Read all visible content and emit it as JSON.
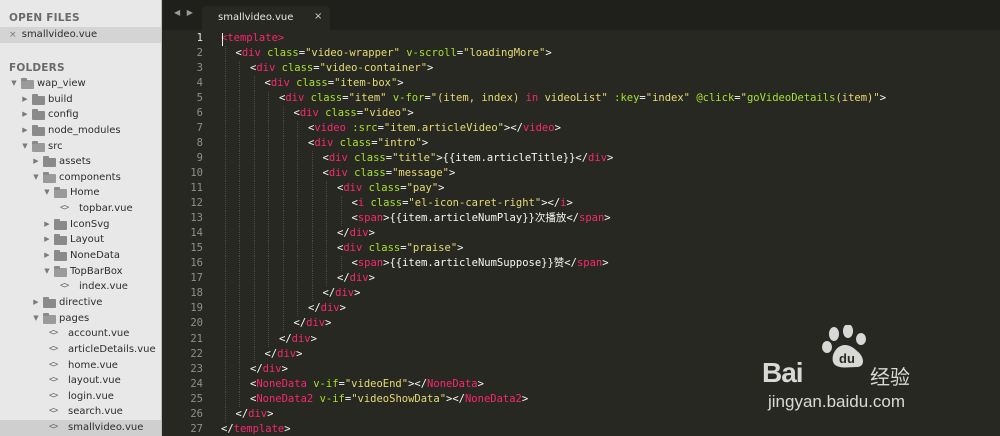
{
  "sidebar": {
    "open_files_title": "OPEN FILES",
    "open_files": [
      {
        "name": "smallvideo.vue",
        "close_glyph": "×"
      }
    ],
    "folders_title": "FOLDERS",
    "tree": [
      {
        "name": "wap_view",
        "type": "folder",
        "level": 0,
        "expanded": true
      },
      {
        "name": "build",
        "type": "folder",
        "level": 1,
        "expanded": false
      },
      {
        "name": "config",
        "type": "folder",
        "level": 1,
        "expanded": false
      },
      {
        "name": "node_modules",
        "type": "folder",
        "level": 1,
        "expanded": false
      },
      {
        "name": "src",
        "type": "folder",
        "level": 1,
        "expanded": true
      },
      {
        "name": "assets",
        "type": "folder",
        "level": 2,
        "expanded": false
      },
      {
        "name": "components",
        "type": "folder",
        "level": 2,
        "expanded": true
      },
      {
        "name": "Home",
        "type": "folder",
        "level": 3,
        "expanded": true
      },
      {
        "name": "topbar.vue",
        "type": "file",
        "level": 4
      },
      {
        "name": "IconSvg",
        "type": "folder",
        "level": 3,
        "expanded": false
      },
      {
        "name": "Layout",
        "type": "folder",
        "level": 3,
        "expanded": false
      },
      {
        "name": "NoneData",
        "type": "folder",
        "level": 3,
        "expanded": false
      },
      {
        "name": "TopBarBox",
        "type": "folder",
        "level": 3,
        "expanded": true
      },
      {
        "name": "index.vue",
        "type": "file",
        "level": 4
      },
      {
        "name": "directive",
        "type": "folder",
        "level": 2,
        "expanded": false
      },
      {
        "name": "pages",
        "type": "folder",
        "level": 2,
        "expanded": true
      },
      {
        "name": "account.vue",
        "type": "file",
        "level": 3
      },
      {
        "name": "articleDetails.vue",
        "type": "file",
        "level": 3
      },
      {
        "name": "home.vue",
        "type": "file",
        "level": 3
      },
      {
        "name": "layout.vue",
        "type": "file",
        "level": 3
      },
      {
        "name": "login.vue",
        "type": "file",
        "level": 3
      },
      {
        "name": "search.vue",
        "type": "file",
        "level": 3
      },
      {
        "name": "smallvideo.vue",
        "type": "file",
        "level": 3,
        "selected": true
      }
    ]
  },
  "tabbar": {
    "nav_arrows": "◀ ▶",
    "active_tab": {
      "label": "smallvideo.vue",
      "close_glyph": "×"
    }
  },
  "editor": {
    "current_line": 1,
    "lines": [
      {
        "n": "1",
        "indent": 0,
        "tokens": [
          [
            "t",
            "<template>"
          ]
        ]
      },
      {
        "n": "2",
        "indent": 1,
        "tokens": [
          [
            "p",
            "<"
          ],
          [
            "t",
            "div"
          ],
          [
            "p",
            " "
          ],
          [
            "a",
            "class"
          ],
          [
            "p",
            "="
          ],
          [
            "s",
            "\"video-wrapper\""
          ],
          [
            "p",
            " "
          ],
          [
            "a",
            "v-scroll"
          ],
          [
            "p",
            "="
          ],
          [
            "s",
            "\"loadingMore\""
          ],
          [
            "p",
            ">"
          ]
        ]
      },
      {
        "n": "3",
        "indent": 2,
        "tokens": [
          [
            "p",
            "<"
          ],
          [
            "t",
            "div"
          ],
          [
            "p",
            " "
          ],
          [
            "a",
            "class"
          ],
          [
            "p",
            "="
          ],
          [
            "s",
            "\"video-container\""
          ],
          [
            "p",
            ">"
          ]
        ]
      },
      {
        "n": "4",
        "indent": 3,
        "tokens": [
          [
            "p",
            "<"
          ],
          [
            "t",
            "div"
          ],
          [
            "p",
            " "
          ],
          [
            "a",
            "class"
          ],
          [
            "p",
            "="
          ],
          [
            "s",
            "\"item-box\""
          ],
          [
            "p",
            ">"
          ]
        ]
      },
      {
        "n": "5",
        "indent": 4,
        "tokens": [
          [
            "p",
            "<"
          ],
          [
            "t",
            "div"
          ],
          [
            "p",
            " "
          ],
          [
            "a",
            "class"
          ],
          [
            "p",
            "="
          ],
          [
            "s",
            "\"item\""
          ],
          [
            "p",
            " "
          ],
          [
            "a",
            "v-for"
          ],
          [
            "p",
            "="
          ],
          [
            "s",
            "\"(item, index) "
          ],
          [
            "k",
            "in"
          ],
          [
            "s",
            " videoList\""
          ],
          [
            "p",
            " "
          ],
          [
            "a",
            ":key"
          ],
          [
            "p",
            "="
          ],
          [
            "s",
            "\"index\""
          ],
          [
            "p",
            " "
          ],
          [
            "a",
            "@click"
          ],
          [
            "p",
            "="
          ],
          [
            "s",
            "\""
          ],
          [
            "a",
            "goVideoDetails"
          ],
          [
            "s",
            "(item)\""
          ],
          [
            "p",
            ">"
          ]
        ]
      },
      {
        "n": "6",
        "indent": 5,
        "tokens": [
          [
            "p",
            "<"
          ],
          [
            "t",
            "div"
          ],
          [
            "p",
            " "
          ],
          [
            "a",
            "class"
          ],
          [
            "p",
            "="
          ],
          [
            "s",
            "\"video\""
          ],
          [
            "p",
            ">"
          ]
        ]
      },
      {
        "n": "7",
        "indent": 6,
        "tokens": [
          [
            "p",
            "<"
          ],
          [
            "t",
            "video"
          ],
          [
            "p",
            " "
          ],
          [
            "a",
            ":src"
          ],
          [
            "p",
            "="
          ],
          [
            "s",
            "\"item.articleVideo\""
          ],
          [
            "p",
            "></"
          ],
          [
            "t",
            "video"
          ],
          [
            "p",
            ">"
          ]
        ]
      },
      {
        "n": "8",
        "indent": 6,
        "tokens": [
          [
            "p",
            "<"
          ],
          [
            "t",
            "div"
          ],
          [
            "p",
            " "
          ],
          [
            "a",
            "class"
          ],
          [
            "p",
            "="
          ],
          [
            "s",
            "\"intro\""
          ],
          [
            "p",
            ">"
          ]
        ]
      },
      {
        "n": "9",
        "indent": 7,
        "tokens": [
          [
            "p",
            "<"
          ],
          [
            "t",
            "div"
          ],
          [
            "p",
            " "
          ],
          [
            "a",
            "class"
          ],
          [
            "p",
            "="
          ],
          [
            "s",
            "\"title\""
          ],
          [
            "p",
            ">{{item.articleTitle}}</"
          ],
          [
            "t",
            "div"
          ],
          [
            "p",
            ">"
          ]
        ]
      },
      {
        "n": "10",
        "indent": 7,
        "tokens": [
          [
            "p",
            "<"
          ],
          [
            "t",
            "div"
          ],
          [
            "p",
            " "
          ],
          [
            "a",
            "class"
          ],
          [
            "p",
            "="
          ],
          [
            "s",
            "\"message\""
          ],
          [
            "p",
            ">"
          ]
        ]
      },
      {
        "n": "11",
        "indent": 8,
        "tokens": [
          [
            "p",
            "<"
          ],
          [
            "t",
            "div"
          ],
          [
            "p",
            " "
          ],
          [
            "a",
            "class"
          ],
          [
            "p",
            "="
          ],
          [
            "s",
            "\"pay\""
          ],
          [
            "p",
            ">"
          ]
        ]
      },
      {
        "n": "12",
        "indent": 9,
        "tokens": [
          [
            "p",
            "<"
          ],
          [
            "t",
            "i"
          ],
          [
            "p",
            " "
          ],
          [
            "a",
            "class"
          ],
          [
            "p",
            "="
          ],
          [
            "s",
            "\"el-icon-caret-right\""
          ],
          [
            "p",
            "></"
          ],
          [
            "t",
            "i"
          ],
          [
            "p",
            ">"
          ]
        ]
      },
      {
        "n": "13",
        "indent": 9,
        "tokens": [
          [
            "p",
            "<"
          ],
          [
            "t",
            "span"
          ],
          [
            "p",
            ">{{item.articleNumPlay}}次播放</"
          ],
          [
            "t",
            "span"
          ],
          [
            "p",
            ">"
          ]
        ]
      },
      {
        "n": "14",
        "indent": 8,
        "tokens": [
          [
            "p",
            "</"
          ],
          [
            "t",
            "div"
          ],
          [
            "p",
            ">"
          ]
        ]
      },
      {
        "n": "15",
        "indent": 8,
        "tokens": [
          [
            "p",
            "<"
          ],
          [
            "t",
            "div"
          ],
          [
            "p",
            " "
          ],
          [
            "a",
            "class"
          ],
          [
            "p",
            "="
          ],
          [
            "s",
            "\"praise\""
          ],
          [
            "p",
            ">"
          ]
        ]
      },
      {
        "n": "16",
        "indent": 9,
        "tokens": [
          [
            "p",
            "<"
          ],
          [
            "t",
            "span"
          ],
          [
            "p",
            ">{{item.articleNumSuppose}}赞</"
          ],
          [
            "t",
            "span"
          ],
          [
            "p",
            ">"
          ]
        ]
      },
      {
        "n": "17",
        "indent": 8,
        "tokens": [
          [
            "p",
            "</"
          ],
          [
            "t",
            "div"
          ],
          [
            "p",
            ">"
          ]
        ]
      },
      {
        "n": "18",
        "indent": 7,
        "tokens": [
          [
            "p",
            "</"
          ],
          [
            "t",
            "div"
          ],
          [
            "p",
            ">"
          ]
        ]
      },
      {
        "n": "19",
        "indent": 6,
        "tokens": [
          [
            "p",
            "</"
          ],
          [
            "t",
            "div"
          ],
          [
            "p",
            ">"
          ]
        ]
      },
      {
        "n": "20",
        "indent": 5,
        "tokens": [
          [
            "p",
            "</"
          ],
          [
            "t",
            "div"
          ],
          [
            "p",
            ">"
          ]
        ]
      },
      {
        "n": "21",
        "indent": 4,
        "tokens": [
          [
            "p",
            "</"
          ],
          [
            "t",
            "div"
          ],
          [
            "p",
            ">"
          ]
        ]
      },
      {
        "n": "22",
        "indent": 3,
        "tokens": [
          [
            "p",
            "</"
          ],
          [
            "t",
            "div"
          ],
          [
            "p",
            ">"
          ]
        ]
      },
      {
        "n": "23",
        "indent": 2,
        "tokens": [
          [
            "p",
            "</"
          ],
          [
            "t",
            "div"
          ],
          [
            "p",
            ">"
          ]
        ]
      },
      {
        "n": "24",
        "indent": 2,
        "tokens": [
          [
            "p",
            "<"
          ],
          [
            "t",
            "NoneData"
          ],
          [
            "p",
            " "
          ],
          [
            "a",
            "v-if"
          ],
          [
            "p",
            "="
          ],
          [
            "s",
            "\"videoEnd\""
          ],
          [
            "p",
            "></"
          ],
          [
            "t",
            "NoneData"
          ],
          [
            "p",
            ">"
          ]
        ]
      },
      {
        "n": "25",
        "indent": 2,
        "tokens": [
          [
            "p",
            "<"
          ],
          [
            "t",
            "NoneData2"
          ],
          [
            "p",
            " "
          ],
          [
            "a",
            "v-if"
          ],
          [
            "p",
            "="
          ],
          [
            "s",
            "\"videoShowData\""
          ],
          [
            "p",
            "></"
          ],
          [
            "t",
            "NoneData2"
          ],
          [
            "p",
            ">"
          ]
        ]
      },
      {
        "n": "26",
        "indent": 1,
        "tokens": [
          [
            "p",
            "</"
          ],
          [
            "t",
            "div"
          ],
          [
            "p",
            ">"
          ]
        ]
      },
      {
        "n": "27",
        "indent": 0,
        "tokens": [
          [
            "p",
            "</"
          ],
          [
            "t",
            "template"
          ],
          [
            "p",
            ">"
          ]
        ]
      }
    ]
  },
  "watermark": {
    "logo_text": "Bai",
    "logo_text2": "du",
    "cn_text": "经验",
    "url": "jingyan.baidu.com"
  },
  "colors": {
    "tag": "#f92672",
    "attribute": "#a6e22e",
    "string": "#e6db74",
    "plain": "#f8f8f2",
    "background": "#272822"
  }
}
